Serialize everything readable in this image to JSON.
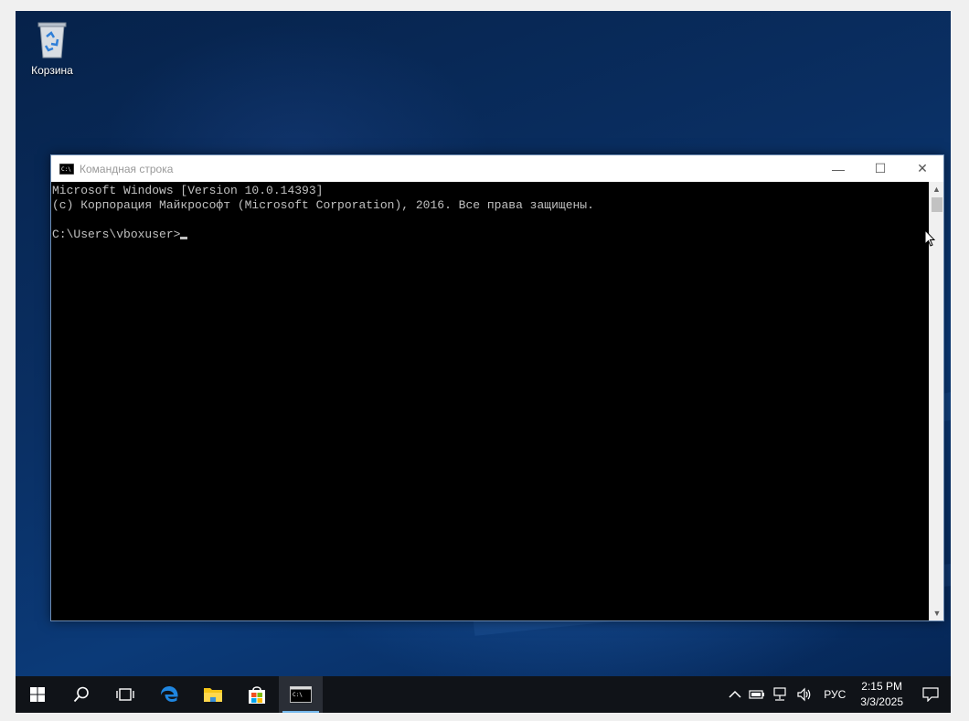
{
  "desktop": {
    "recycle_bin_label": "Корзина"
  },
  "window": {
    "title": "Командная строка",
    "minimize": "—",
    "maximize": "☐",
    "close": "✕",
    "console_lines": [
      "Microsoft Windows [Version 10.0.14393]",
      "(c) Корпорация Майкрософт (Microsoft Corporation), 2016. Все права защищены.",
      "",
      "C:\\Users\\vboxuser>"
    ]
  },
  "taskbar": {
    "start_icon": "windows-logo-icon",
    "search_icon": "search-icon",
    "task_view_icon": "task-view-icon",
    "pinned": [
      "edge-icon",
      "file-explorer-icon",
      "store-icon",
      "cmd-icon"
    ],
    "tray": {
      "chevron": "^",
      "language": "РУС",
      "time": "2:15 PM",
      "date": "3/3/2025"
    }
  },
  "colors": {
    "taskbar_bg": "#101318",
    "accent": "#76b9ed",
    "console_text": "#c0c0c0"
  }
}
